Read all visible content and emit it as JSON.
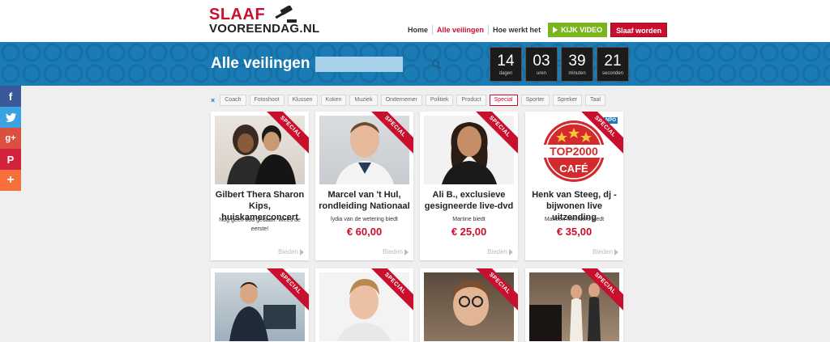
{
  "logo": {
    "line1": "SLAAF",
    "line2": "VOOREENDAG.NL"
  },
  "nav": {
    "home": "Home",
    "auctions": "Alle veilingen",
    "how": "Hoe werkt het",
    "video": "KIJK VIDEO",
    "become": "Slaaf worden"
  },
  "banner": {
    "title": "Alle veilingen",
    "search_placeholder": "",
    "countdown": [
      {
        "value": "14",
        "label": "dagen"
      },
      {
        "value": "03",
        "label": "uren"
      },
      {
        "value": "39",
        "label": "minuten"
      },
      {
        "value": "21",
        "label": "seconden"
      }
    ]
  },
  "social": {
    "facebook": "f",
    "twitter": "t",
    "googleplus": "g+",
    "pinterest": "P",
    "more": "+"
  },
  "filters": {
    "clear": "×",
    "chips": [
      "Coach",
      "Fotoshoot",
      "Klussen",
      "Koken",
      "Muziek",
      "Ondernemer",
      "Politiek",
      "Product",
      "Special",
      "Sporter",
      "Spreker",
      "Taal"
    ],
    "active": "Special"
  },
  "cards": [
    {
      "ribbon": "SPECIAL",
      "title": "Gilbert Thera Sharon Kips, huiskamerconcert",
      "nobid": "Nog geen bod gedaan. Wees de eerste!",
      "bid": "Bieden"
    },
    {
      "ribbon": "SPECIAL",
      "title": "Marcel van 't Hul, rondleiding Nationaal",
      "bidder": "lydia van de wetering biedt",
      "price": "€ 60,00",
      "bid": "Bieden"
    },
    {
      "ribbon": "SPECIAL",
      "title": "Ali B., exclusieve gesigneerde live-dvd",
      "bidder": "Martine biedt",
      "price": "€ 25,00",
      "bid": "Bieden"
    },
    {
      "ribbon": "SPECIAL",
      "title": "Henk van Steeg, dj - bijwonen live uitzending",
      "bidder": "Marleen Meinders biedt",
      "price": "€ 35,00",
      "bid": "Bieden",
      "logo_text": "TOP2000",
      "logo_sub": "CAFÉ",
      "logo_badge": "NPO"
    },
    {
      "ribbon": "SPECIAL"
    },
    {
      "ribbon": "SPECIAL"
    },
    {
      "ribbon": "SPECIAL"
    },
    {
      "ribbon": "SPECIAL"
    }
  ],
  "colors": {
    "brand_red": "#c8102e",
    "banner_blue": "#1a7bb5",
    "video_green": "#7ab51d"
  }
}
